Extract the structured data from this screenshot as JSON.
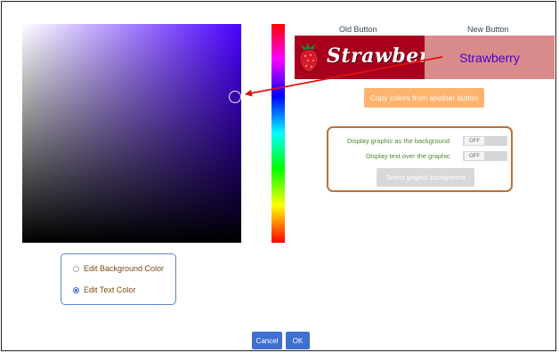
{
  "header": {
    "old_button_title": "Old Button",
    "new_button_title": "New Button"
  },
  "preview": {
    "old_label": "Strawberry",
    "new_label": "Strawberry",
    "old_bg_color": "#a8001d",
    "new_bg_color": "#d98b8b",
    "new_text_color": "#4a00cc"
  },
  "picker": {
    "hue_color": "#4a00ff"
  },
  "actions": {
    "copy_colors_label": "Copy colors from another button",
    "select_graphic_label": "Select graphic background"
  },
  "graphic_options": {
    "display_background_label": "Display graphic as the background",
    "display_background_value": "OFF",
    "display_text_label": "Display text over the graphic",
    "display_text_value": "OFF"
  },
  "edit_mode": {
    "background_label": "Edit Background Color",
    "text_label": "Edit Text Color",
    "selected": "text"
  },
  "footer": {
    "cancel_label": "Cancel",
    "ok_label": "OK"
  }
}
